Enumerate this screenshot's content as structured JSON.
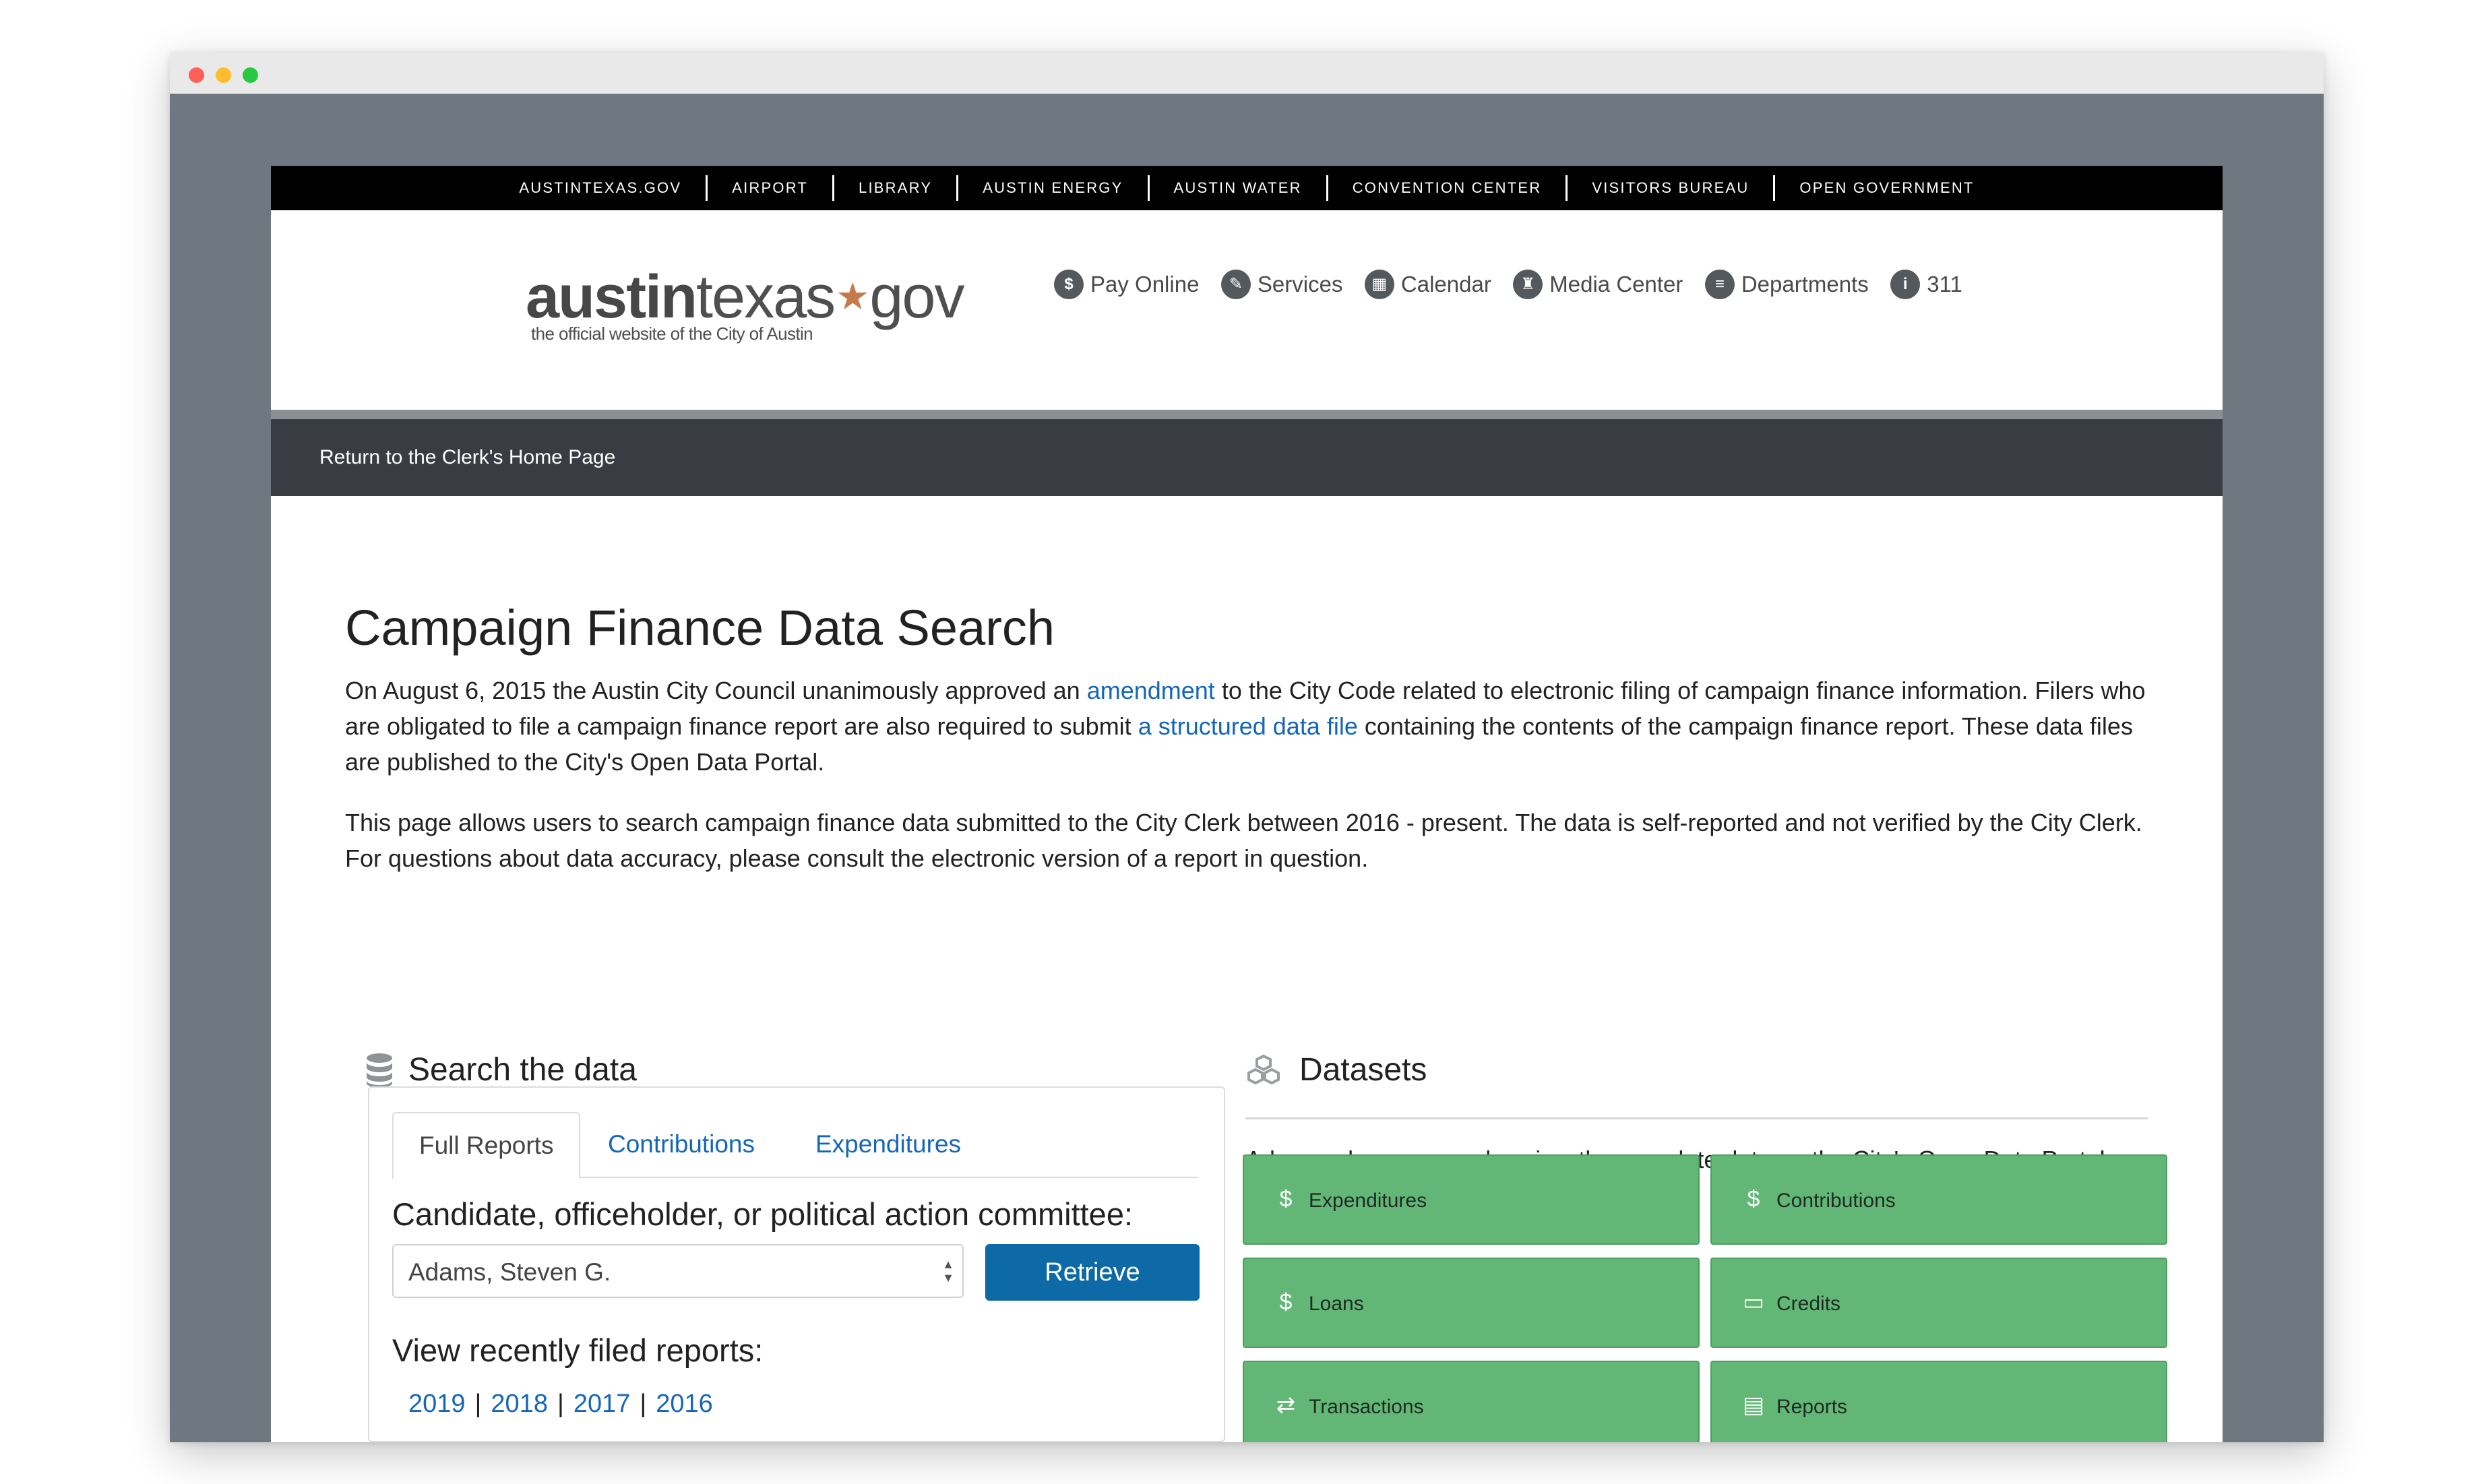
{
  "top_links": [
    "AUSTINTEXAS.GOV",
    "AIRPORT",
    "LIBRARY",
    "AUSTIN ENERGY",
    "AUSTIN WATER",
    "CONVENTION CENTER",
    "VISITORS BUREAU",
    "OPEN GOVERNMENT"
  ],
  "logo": {
    "part1": "austin",
    "part2": "texas",
    "part3": "gov",
    "tagline": "the official website of the City of Austin"
  },
  "header_nav": [
    {
      "label": "Pay Online",
      "icon": "pay-online-icon",
      "glyph": "$"
    },
    {
      "label": "Services",
      "icon": "services-icon",
      "glyph": "✎"
    },
    {
      "label": "Calendar",
      "icon": "calendar-icon",
      "glyph": "▦"
    },
    {
      "label": "Media Center",
      "icon": "media-center-icon",
      "glyph": "♜"
    },
    {
      "label": "Departments",
      "icon": "departments-icon",
      "glyph": "≡"
    },
    {
      "label": "311",
      "icon": "info-icon",
      "glyph": "i"
    }
  ],
  "subnav": {
    "return_link": "Return to the Clerk's Home Page"
  },
  "page": {
    "title": "Campaign Finance Data Search",
    "p1_a": "On August 6, 2015 the Austin City Council unanimously approved an ",
    "p1_link1": "amendment",
    "p1_b": " to the City Code related to electronic filing of campaign finance information. Filers who are obligated to file a campaign finance report are also required to submit ",
    "p1_link2": "a structured data file",
    "p1_c": " containing the contents of the campaign finance report. These data files are published to the City's Open Data Portal.",
    "p2": "This page allows users to search campaign finance data submitted to the City Clerk between 2016 - present. The data is self-reported and not verified by the City Clerk. For questions about data accuracy, please consult the electronic version of a report in question."
  },
  "search": {
    "title": "Search the data",
    "tabs": [
      "Full Reports",
      "Contributions",
      "Expenditures"
    ],
    "candidate_label": "Candidate, officeholder, or political action committee:",
    "selected_candidate": "Adams, Steven G.",
    "retrieve_label": "Retrieve",
    "recent_label": "View recently filed reports:",
    "years": [
      "2019",
      "2018",
      "2017",
      "2016"
    ]
  },
  "datasets": {
    "title": "Datasets",
    "intro": "Advanced users can also view the complete data on the City's Open Data Portal.",
    "tiles": [
      {
        "label": "Expenditures",
        "icon": "dollar-icon",
        "glyph": "$"
      },
      {
        "label": "Contributions",
        "icon": "coin-hand-icon",
        "glyph": "$"
      },
      {
        "label": "Loans",
        "icon": "loan-hand-icon",
        "glyph": "$"
      },
      {
        "label": "Credits",
        "icon": "credit-card-icon",
        "glyph": "▭"
      },
      {
        "label": "Transactions",
        "icon": "exchange-icon",
        "glyph": "⇄"
      },
      {
        "label": "Reports",
        "icon": "document-icon",
        "glyph": "▤"
      }
    ]
  },
  "colors": {
    "accent": "#0d6aa6",
    "link": "#1666b8",
    "tile": "#62b776",
    "dark_nav": "#393c42"
  }
}
